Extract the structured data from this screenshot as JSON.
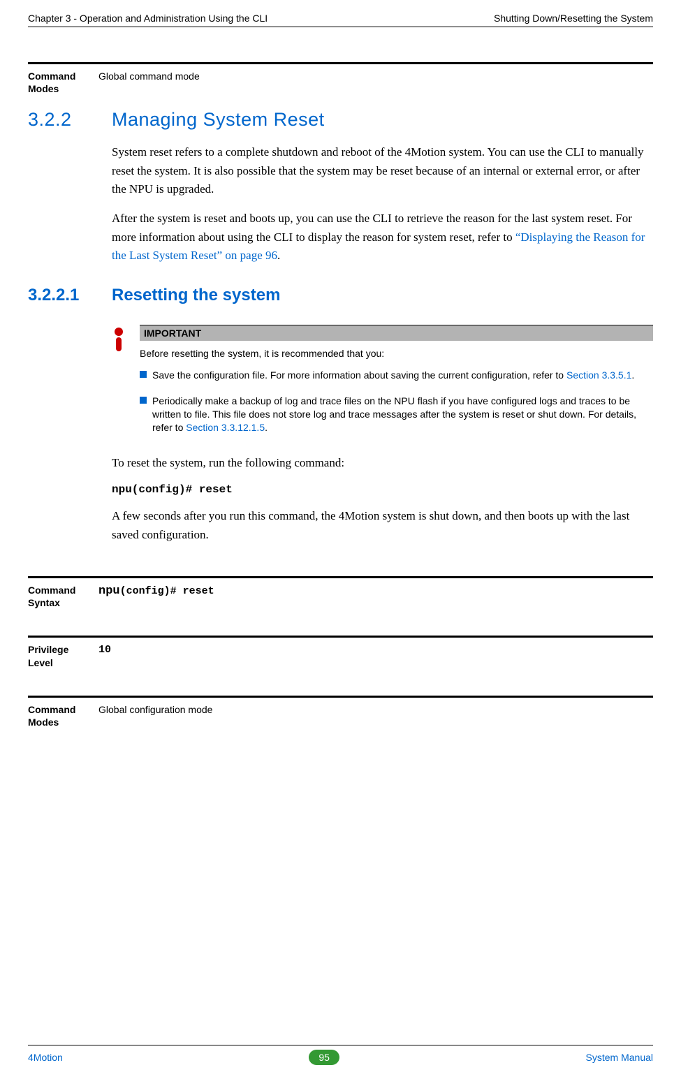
{
  "header": {
    "left": "Chapter 3 - Operation and Administration Using the CLI",
    "right": "Shutting Down/Resetting the System"
  },
  "block_modes_top": {
    "label": "Command Modes",
    "value": "Global command mode"
  },
  "section": {
    "num": "3.2.2",
    "title": "Managing System Reset",
    "para1": "System reset refers to a complete shutdown and reboot of the 4Motion system. You can use the CLI to manually reset the system. It is also possible that the system may be reset because of an internal or external error, or after the NPU is upgraded.",
    "para2_a": "After the system is reset and boots up, you can use the CLI to retrieve the reason for the last system reset. For more information about using the CLI to display the reason for system reset, refer to ",
    "para2_link": "“Displaying the Reason for the Last System Reset” on page 96",
    "para2_b": "."
  },
  "subsection": {
    "num": "3.2.2.1",
    "title": "Resetting the system"
  },
  "important": {
    "header": "IMPORTANT",
    "intro": "Before resetting the system, it is recommended that you:",
    "b1_a": "Save the configuration file. For more information about saving the current configuration, refer to ",
    "b1_link": "Section 3.3.5.1",
    "b1_b": ".",
    "b2_a": "Periodically make a backup of log and trace files on the NPU flash if you have configured logs and traces to be written to file. This file does not store log and trace messages after the system is reset or shut down. For details, refer to ",
    "b2_link": "Section 3.3.12.1.5",
    "b2_b": "."
  },
  "body2": {
    "p1": "To reset the system, run the following command:",
    "cmd": "npu(config)# reset",
    "p2": "A few seconds after you run this command, the 4Motion system is shut down, and then boots up with the last saved configuration."
  },
  "block_syntax": {
    "label": "Command Syntax",
    "npu": "npu",
    "rest": "(config)# reset"
  },
  "block_priv": {
    "label": "Privilege Level",
    "value": "10"
  },
  "block_modes_bottom": {
    "label": "Command Modes",
    "value": "Global configuration mode"
  },
  "footer": {
    "left": "4Motion",
    "page": "95",
    "right": "System Manual"
  }
}
